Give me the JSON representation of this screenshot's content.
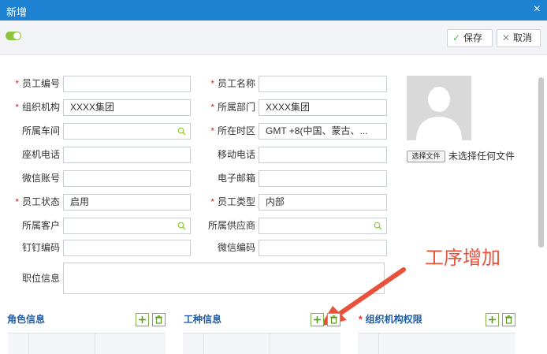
{
  "window": {
    "title": "新增",
    "close_glyph": "×"
  },
  "toolbar": {
    "toggle_state": "on",
    "save_label": "保存",
    "cancel_label": "取消",
    "save_icon": "check-icon",
    "cancel_icon": "close-icon",
    "accent_color": "#1d82d2"
  },
  "form": {
    "employee_no": {
      "label": "员工编号",
      "required": true,
      "value": ""
    },
    "employee_name": {
      "label": "员工名称",
      "required": true,
      "value": ""
    },
    "organization": {
      "label": "组织机构",
      "required": true,
      "value": "XXXX集团"
    },
    "department": {
      "label": "所属部门",
      "required": true,
      "value": "XXXX集团"
    },
    "workshop": {
      "label": "所属车间",
      "required": false,
      "value": ""
    },
    "timezone": {
      "label": "所在时区",
      "required": true,
      "value": "GMT +8(中国、蒙古、..."
    },
    "landline": {
      "label": "座机电话",
      "required": false,
      "value": ""
    },
    "mobile": {
      "label": "移动电话",
      "required": false,
      "value": ""
    },
    "wechat": {
      "label": "微信账号",
      "required": false,
      "value": ""
    },
    "email": {
      "label": "电子邮箱",
      "required": false,
      "value": ""
    },
    "status": {
      "label": "员工状态",
      "required": true,
      "value": "启用"
    },
    "type": {
      "label": "员工类型",
      "required": true,
      "value": "内部"
    },
    "customer": {
      "label": "所属客户",
      "required": false,
      "value": ""
    },
    "supplier": {
      "label": "所属供应商",
      "required": false,
      "value": ""
    },
    "dingtalk": {
      "label": "钉钉编码",
      "required": false,
      "value": ""
    },
    "wechat_code": {
      "label": "微信编码",
      "required": false,
      "value": ""
    },
    "position": {
      "label": "职位信息",
      "required": false,
      "value": ""
    }
  },
  "photo": {
    "choose_button": "选择文件",
    "status": "未选择任何文件"
  },
  "annotation": {
    "text": "工序增加",
    "color": "#e8523a"
  },
  "sections": {
    "roles": {
      "title": "角色信息",
      "required": false
    },
    "work_types": {
      "title": "工种信息",
      "required": false
    },
    "org_permissions": {
      "title": "组织机构权限",
      "required": true
    }
  }
}
